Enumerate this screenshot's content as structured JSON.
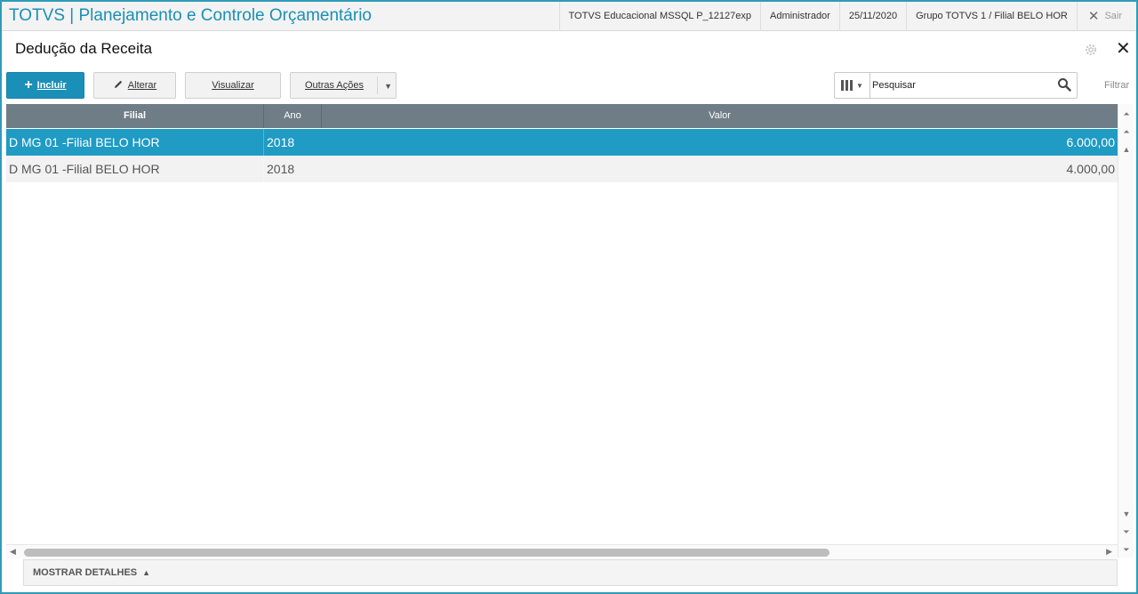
{
  "header": {
    "app_title": "TOTVS | Planejamento e Controle Orçamentário",
    "environment": "TOTVS Educacional MSSQL P_12127exp",
    "user": "Administrador",
    "date": "25/11/2020",
    "branch": "Grupo TOTVS 1 / Filial BELO HOR",
    "exit_label": "Sair"
  },
  "page": {
    "title": "Dedução da Receita"
  },
  "toolbar": {
    "include_label": "Incluir",
    "edit_label": "Alterar",
    "view_label": "Visualizar",
    "other_actions_label": "Outras Ações"
  },
  "search": {
    "value": "Pesquisar",
    "filter_label": "Filtrar"
  },
  "grid": {
    "columns": [
      "Filial",
      "Ano",
      "Valor"
    ],
    "rows": [
      {
        "filial": "D MG 01 -Filial BELO HOR",
        "ano": "2018",
        "valor": "6.000,00",
        "selected": true
      },
      {
        "filial": "D MG 01 -Filial BELO HOR",
        "ano": "2018",
        "valor": "4.000,00",
        "selected": false
      }
    ]
  },
  "footer": {
    "details_label": "MOSTRAR DETALHES"
  },
  "colors": {
    "accent": "#1a90b8",
    "selected_row": "#1f9bc4",
    "grid_header": "#6f7d86"
  }
}
